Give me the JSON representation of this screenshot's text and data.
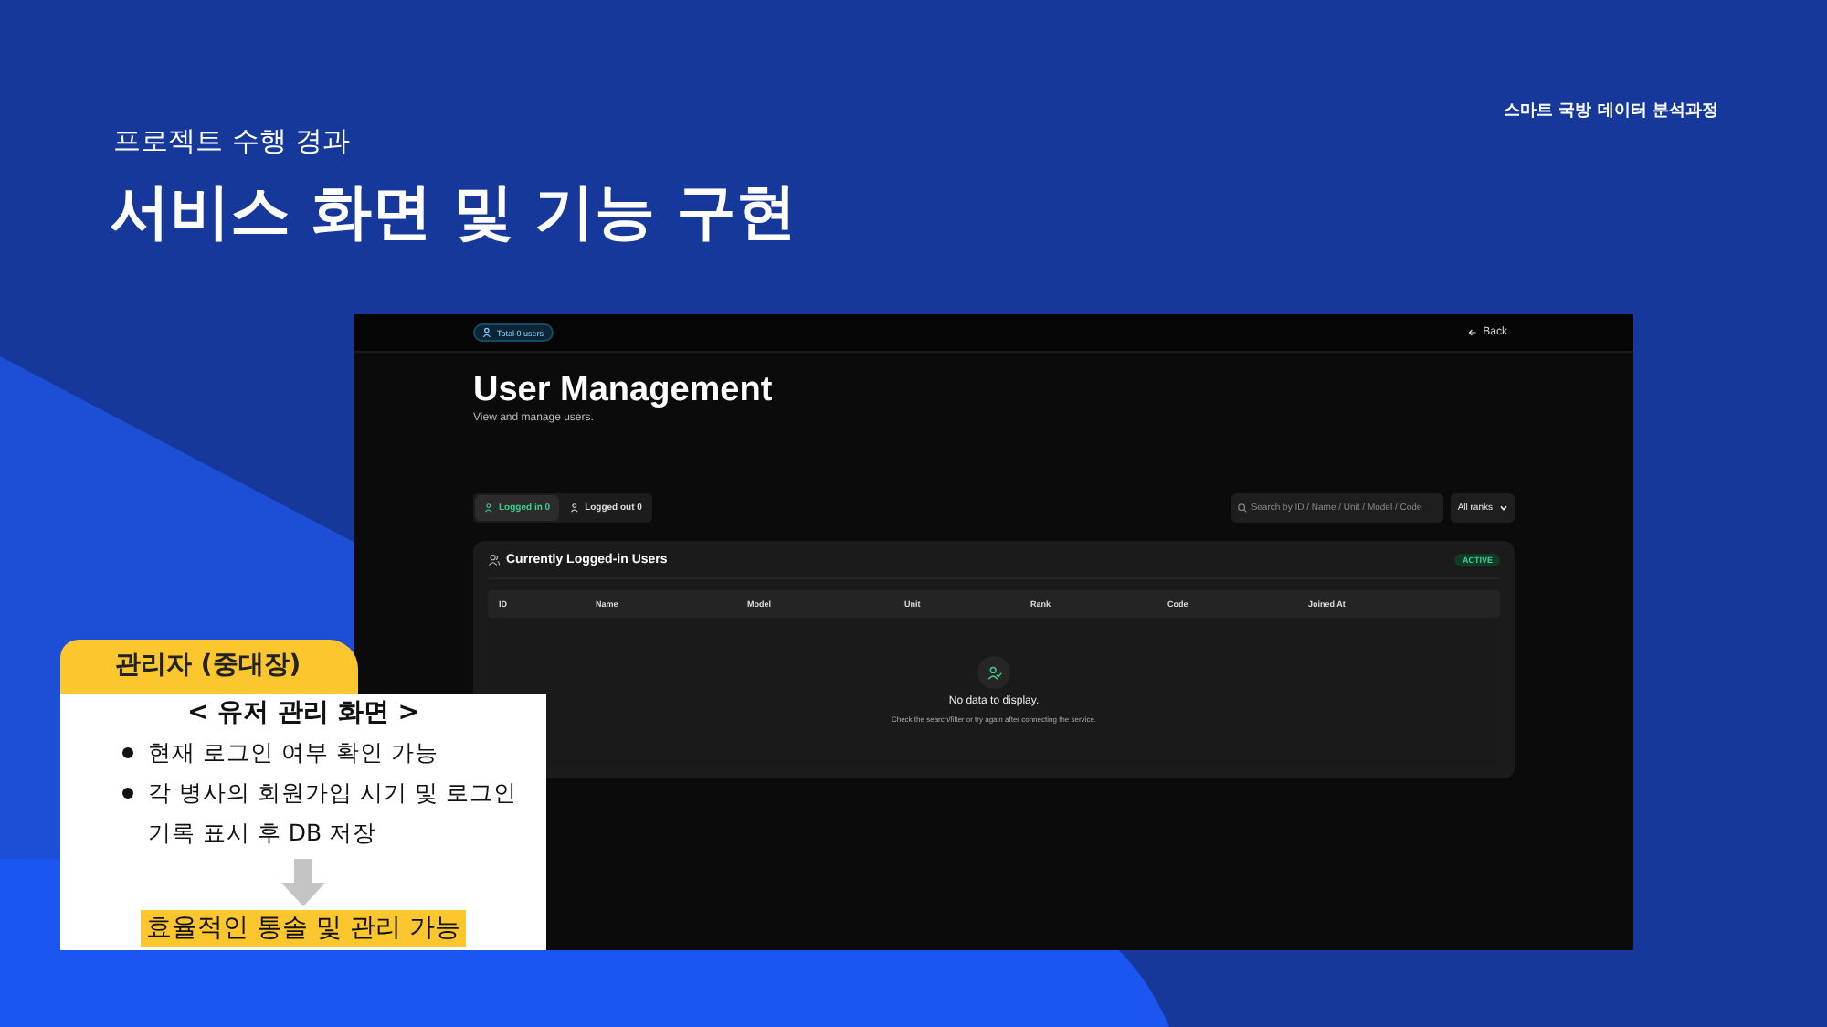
{
  "slide": {
    "course": "스마트 국방 데이터 분석과정",
    "section": "프로젝트 수행 경과",
    "title": "서비스 화면 및 기능 구현"
  },
  "screen": {
    "total_badge": "Total 0 users",
    "back": "Back",
    "title": "User Management",
    "subtitle": "View and manage users.",
    "tabs": [
      {
        "label": "Logged in 0",
        "selected": true
      },
      {
        "label": "Logged out 0",
        "selected": false
      }
    ],
    "search": {
      "placeholder": "Search by ID / Name / Unit / Model / Code"
    },
    "rank_filter": {
      "value": "All ranks"
    },
    "card": {
      "title": "Currently Logged-in Users",
      "status": "ACTIVE"
    },
    "table": {
      "columns": [
        "ID",
        "Name",
        "Model",
        "Unit",
        "Rank",
        "Code",
        "Joined At"
      ],
      "empty": {
        "message": "No data to display.",
        "hint": "Check the search/filter or try again after connecting the service."
      }
    }
  },
  "callout": {
    "tab_label": "관리자 (중대장)",
    "heading": "< 유저 관리 화면 >",
    "bullets": [
      "현재 로그인 여부 확인 가능",
      "각 병사의 회원가입 시기 및 로그인 기록 표시 후 DB 저장"
    ],
    "conclusion": "효율적인 통솔 및 관리 가능"
  }
}
